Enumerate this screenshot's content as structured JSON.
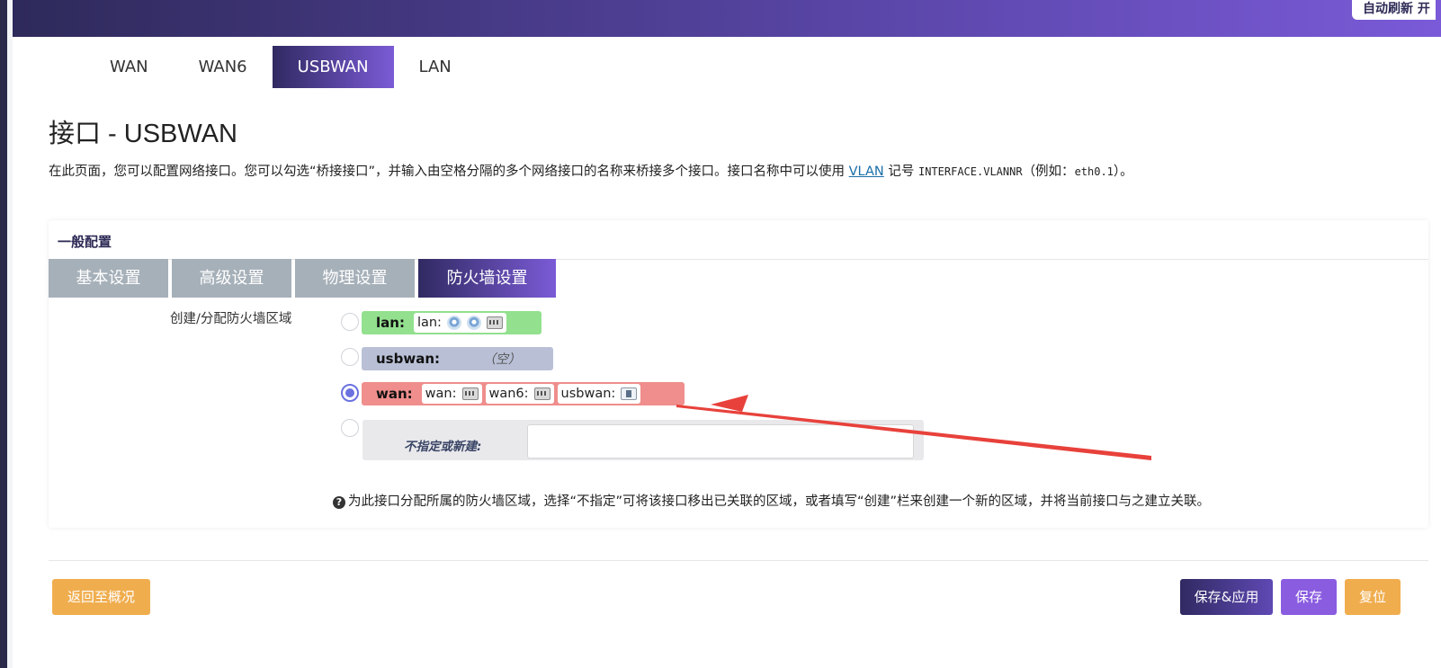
{
  "header": {
    "auto_refresh": "自动刷新 开"
  },
  "interface_tabs": [
    "WAN",
    "WAN6",
    "USBWAN",
    "LAN"
  ],
  "page": {
    "title": "接口 - USBWAN",
    "description_prefix": "在此页面，您可以配置网络接口。您可以勾选“桥接接口”，并输入由空格分隔的多个网络接口的名称来桥接多个接口。接口名称中可以使用",
    "description_link": "VLAN",
    "description_mid": "记号",
    "description_code": "INTERFACE.VLANNR",
    "description_suffix_pre": "（例如：",
    "description_example": "eth0.1",
    "description_suffix_post": "）。"
  },
  "section": {
    "title": "一般配置",
    "tabs": [
      "基本设置",
      "高级设置",
      "物理设置",
      "防火墙设置"
    ],
    "field_label": "创建/分配防火墙区域",
    "zones": [
      {
        "name": "lan:",
        "color": "#93e08f",
        "selected": false,
        "interfaces": [
          {
            "label": "lan:",
            "icons": [
              "wifi-icon",
              "wifi-icon",
              "ethernet-icon"
            ]
          }
        ]
      },
      {
        "name": "usbwan:",
        "color": "#b9c0d6",
        "selected": false,
        "empty_text": "（空）",
        "interfaces": []
      },
      {
        "name": "wan:",
        "color": "#ef8e8c",
        "selected": true,
        "interfaces": [
          {
            "label": "wan:",
            "icons": [
              "ethernet-icon"
            ]
          },
          {
            "label": "wan6:",
            "icons": [
              "ethernet-icon"
            ]
          },
          {
            "label": "usbwan:",
            "icons": [
              "usb-icon"
            ]
          }
        ]
      }
    ],
    "custom_label": "不指定或新建:",
    "custom_value": "",
    "help_text": "为此接口分配所属的防火墙区域，选择“不指定”可将该接口移出已关联的区域，或者填写“创建”栏来创建一个新的区域，并将当前接口与之建立关联。"
  },
  "footer": {
    "back": "返回至概况",
    "save_apply": "保存&应用",
    "save": "保存",
    "reset": "复位"
  },
  "colors": {
    "accent_dark": "#302a62",
    "accent_light": "#7b5bd6",
    "orange": "#f0ad4e",
    "purple": "#8a5ce0",
    "annotation_arrow": "#e8413b"
  }
}
